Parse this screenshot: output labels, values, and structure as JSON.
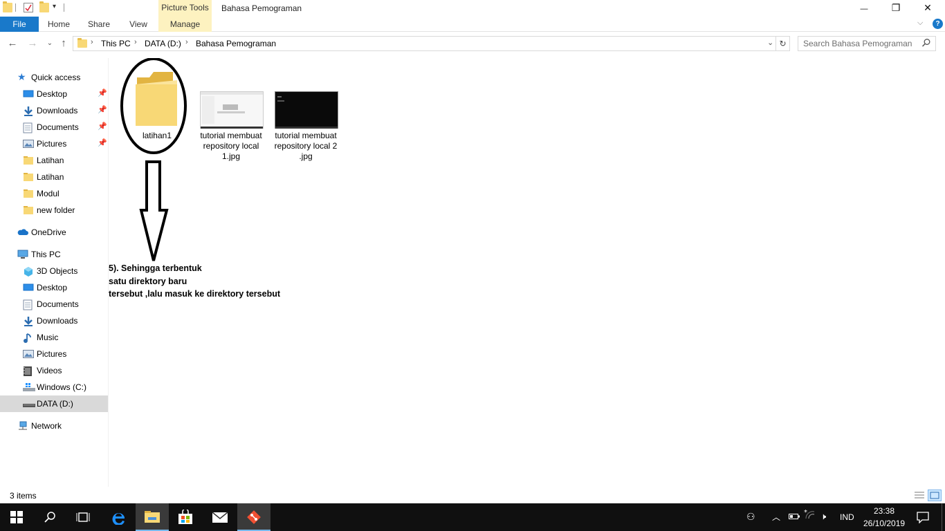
{
  "window": {
    "title": "Bahasa Pemograman",
    "context_tab_group": "Picture Tools",
    "minimize_glyph": "—",
    "restore_glyph": "❐",
    "close_glyph": "✕"
  },
  "ribbon": {
    "tabs": [
      {
        "label": "File"
      },
      {
        "label": "Home"
      },
      {
        "label": "Share"
      },
      {
        "label": "View"
      },
      {
        "label": "Manage"
      }
    ],
    "help_glyph": "?"
  },
  "address": {
    "crumbs": [
      "This PC",
      "DATA (D:)",
      "Bahasa Pemograman"
    ],
    "separator": "›"
  },
  "search": {
    "placeholder": "Search Bahasa Pemograman"
  },
  "navpane": {
    "quick_access": "Quick access",
    "quick_items": [
      {
        "label": "Desktop",
        "icon": "desktop-icon",
        "pinned": true
      },
      {
        "label": "Downloads",
        "icon": "downloads-icon",
        "pinned": true
      },
      {
        "label": "Documents",
        "icon": "documents-icon",
        "pinned": true
      },
      {
        "label": "Pictures",
        "icon": "pictures-icon",
        "pinned": true
      },
      {
        "label": "Latihan",
        "icon": "folder-icon",
        "pinned": false
      },
      {
        "label": "Latihan",
        "icon": "folder-icon",
        "pinned": false
      },
      {
        "label": "Modul",
        "icon": "folder-icon",
        "pinned": false
      },
      {
        "label": "new folder",
        "icon": "folder-icon",
        "pinned": false
      }
    ],
    "onedrive": "OneDrive",
    "this_pc": "This PC",
    "pc_items": [
      {
        "label": "3D Objects",
        "icon": "3d-objects-icon"
      },
      {
        "label": "Desktop",
        "icon": "desktop-icon"
      },
      {
        "label": "Documents",
        "icon": "documents-icon"
      },
      {
        "label": "Downloads",
        "icon": "downloads-icon"
      },
      {
        "label": "Music",
        "icon": "music-icon"
      },
      {
        "label": "Pictures",
        "icon": "pictures-icon"
      },
      {
        "label": "Videos",
        "icon": "videos-icon"
      },
      {
        "label": "Windows (C:)",
        "icon": "windows-drive-icon"
      },
      {
        "label": "DATA (D:)",
        "icon": "data-drive-icon"
      }
    ],
    "network": "Network"
  },
  "files": [
    {
      "name": "latihan1",
      "type": "folder"
    },
    {
      "name": "tutorial membuat repository local 1.jpg",
      "type": "image-light"
    },
    {
      "name": "tutorial membuat repository local 2 .jpg",
      "type": "image-dark"
    }
  ],
  "annotation": {
    "text": "5). Sehingga terbentuk\nsatu direktory baru\ntersebut ,lalu masuk ke direktory tersebut"
  },
  "status": {
    "items_text": "3 items"
  },
  "taskbar": {
    "lang": "IND",
    "time": "23:38",
    "date": "26/10/2019"
  },
  "colors": {
    "accent": "#1979ca",
    "context_tab": "#fdf2c0",
    "selection": "#cde8ff",
    "folder": "#f8d876",
    "taskbar": "#101010"
  }
}
